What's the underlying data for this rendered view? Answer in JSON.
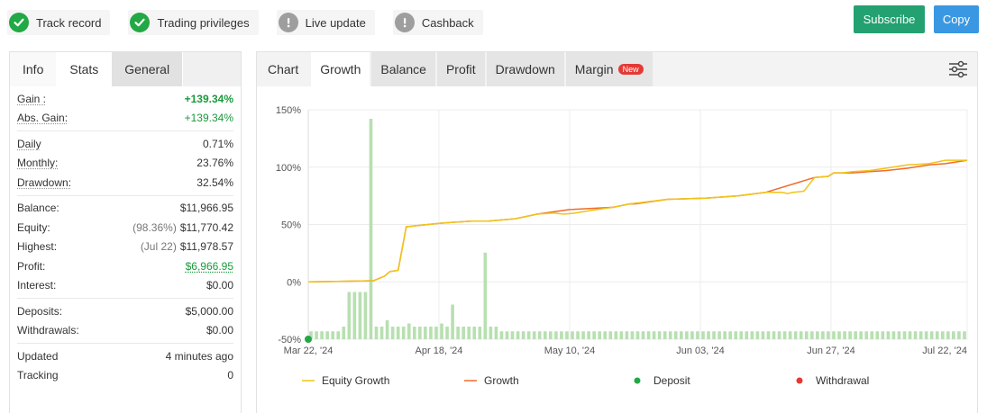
{
  "badges": [
    {
      "label": "Track record",
      "status": "ok"
    },
    {
      "label": "Trading privileges",
      "status": "ok"
    },
    {
      "label": "Live update",
      "status": "warn"
    },
    {
      "label": "Cashback",
      "status": "warn"
    }
  ],
  "actions": {
    "subscribe": "Subscribe",
    "copy": "Copy"
  },
  "left_tabs": [
    "Info",
    "Stats",
    "General"
  ],
  "stats": {
    "gain": {
      "label": "Gain :",
      "value": "+139.34%"
    },
    "abs_gain": {
      "label": "Abs. Gain:",
      "value": "+139.34%"
    },
    "daily": {
      "label": "Daily",
      "value": "0.71%"
    },
    "monthly": {
      "label": "Monthly:",
      "value": "23.76%"
    },
    "drawdown": {
      "label": "Drawdown:",
      "value": "32.54%"
    },
    "balance": {
      "label": "Balance:",
      "value": "$11,966.95"
    },
    "equity": {
      "label": "Equity:",
      "note": "(98.36%)",
      "value": "$11,770.42"
    },
    "highest": {
      "label": "Highest:",
      "note": "(Jul 22)",
      "value": "$11,978.57"
    },
    "profit": {
      "label": "Profit:",
      "value": "$6,966.95"
    },
    "interest": {
      "label": "Interest:",
      "value": "$0.00"
    },
    "deposits": {
      "label": "Deposits:",
      "value": "$5,000.00"
    },
    "withdrawals": {
      "label": "Withdrawals:",
      "value": "$0.00"
    },
    "updated": {
      "label": "Updated",
      "value": "4 minutes ago"
    },
    "tracking": {
      "label": "Tracking",
      "value": "0"
    }
  },
  "right_tabs": [
    "Chart",
    "Growth",
    "Balance",
    "Profit",
    "Drawdown",
    "Margin"
  ],
  "new_badge": "New",
  "colors": {
    "equity": "#f0c419",
    "growth": "#f06a2a",
    "bars": "#b7e0b0",
    "deposit": "#22a845",
    "withdrawal": "#e53935"
  },
  "chart_data": {
    "type": "line",
    "y_ticks": [
      "150%",
      "100%",
      "50%",
      "0%",
      "-50%"
    ],
    "x_ticks": [
      "Mar 22, '24",
      "Apr 18, '24",
      "May 10, '24",
      "Jun 03, '24",
      "Jun 27, '24",
      "Jul 22, '24"
    ],
    "ylim": [
      -50,
      150
    ],
    "legend": [
      "Equity Growth",
      "Growth",
      "Deposit",
      "Withdrawal"
    ],
    "series": [
      {
        "name": "Growth",
        "x": [
          0,
          12,
          14,
          15,
          16.5,
          18,
          20,
          22,
          24,
          27,
          30,
          33,
          38,
          42,
          48,
          56,
          59,
          60,
          66,
          73,
          79,
          84,
          93,
          95.5,
          96.5,
          100,
          103,
          106,
          110,
          114,
          117,
          121
        ],
        "y": [
          0,
          1,
          5,
          9,
          10,
          48,
          49,
          50,
          51,
          52,
          53,
          53,
          55,
          59,
          63,
          65,
          68,
          68,
          72,
          73,
          75,
          78,
          91,
          92,
          95,
          95,
          96,
          97,
          99,
          102,
          103,
          106
        ]
      },
      {
        "name": "Equity Growth",
        "x": [
          0,
          12,
          14,
          15,
          16.5,
          18,
          20,
          22,
          24,
          27,
          30,
          33,
          38,
          42,
          45,
          47,
          49,
          53,
          56,
          59,
          66,
          73,
          79,
          84,
          87,
          88,
          89,
          91,
          93,
          95.5,
          96.5,
          98,
          100,
          103,
          106,
          110,
          114,
          117,
          121
        ],
        "y": [
          0,
          1,
          5,
          9,
          10,
          48,
          49,
          50,
          51,
          52,
          53,
          53,
          55,
          59,
          60,
          59,
          60,
          63,
          65,
          68,
          72,
          73,
          75,
          78,
          78,
          77,
          78,
          79,
          91,
          92,
          95,
          95,
          96,
          97,
          99,
          102,
          103,
          106,
          106
        ]
      }
    ],
    "bars": [
      5,
      5,
      5,
      5,
      5,
      5,
      8,
      30,
      30,
      30,
      30,
      140,
      8,
      8,
      12,
      8,
      8,
      8,
      10,
      8,
      8,
      8,
      8,
      8,
      10,
      8,
      22,
      8,
      8,
      8,
      8,
      8,
      55,
      8,
      8,
      5,
      5,
      5,
      5,
      5,
      5,
      5,
      5,
      5,
      5,
      5,
      5,
      5,
      5,
      5,
      5,
      5,
      5,
      5,
      5,
      5,
      5,
      5,
      5,
      5,
      5,
      5,
      5,
      5,
      5,
      5,
      5,
      5,
      5,
      5,
      5,
      5,
      5,
      5,
      5,
      5,
      5,
      5,
      5,
      5,
      5,
      5,
      5,
      5,
      5,
      5,
      5,
      5,
      5,
      5,
      5,
      5,
      5,
      5,
      5,
      5,
      5,
      5,
      5,
      5,
      5,
      5,
      5,
      5,
      5,
      5,
      5,
      5,
      5,
      5,
      5,
      5,
      5,
      5,
      5,
      5,
      5,
      5,
      5,
      5,
      5
    ]
  }
}
